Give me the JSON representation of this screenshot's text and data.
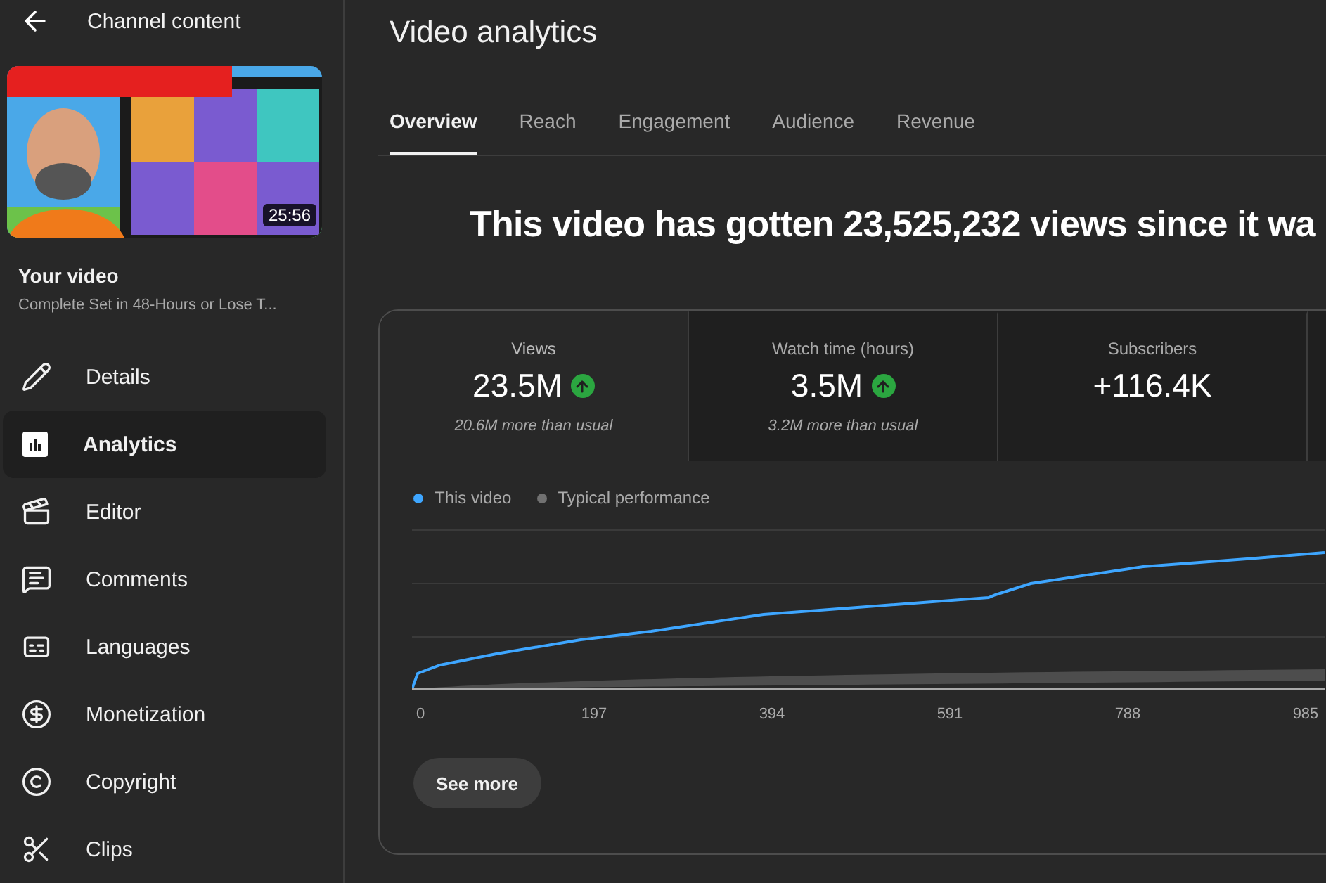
{
  "sidebar": {
    "title": "Channel content",
    "video": {
      "duration": "25:56",
      "label": "Your video",
      "name": "Complete Set in 48-Hours or Lose T..."
    },
    "items": [
      {
        "label": "Details",
        "selected": false
      },
      {
        "label": "Analytics",
        "selected": true
      },
      {
        "label": "Editor",
        "selected": false
      },
      {
        "label": "Comments",
        "selected": false
      },
      {
        "label": "Languages",
        "selected": false
      },
      {
        "label": "Monetization",
        "selected": false
      },
      {
        "label": "Copyright",
        "selected": false
      },
      {
        "label": "Clips",
        "selected": false
      }
    ]
  },
  "page_title": "Video analytics",
  "tabs": [
    {
      "label": "Overview",
      "selected": true
    },
    {
      "label": "Reach",
      "selected": false
    },
    {
      "label": "Engagement",
      "selected": false
    },
    {
      "label": "Audience",
      "selected": false
    },
    {
      "label": "Revenue",
      "selected": false
    }
  ],
  "headline": "This video has gotten 23,525,232 views since it wa",
  "metrics": [
    {
      "label": "Views",
      "value": "23.5M",
      "trending_up": true,
      "note": "20.6M more than usual",
      "selected": true
    },
    {
      "label": "Watch time (hours)",
      "value": "3.5M",
      "trending_up": true,
      "note": "3.2M more than usual",
      "selected": false
    },
    {
      "label": "Subscribers",
      "value": "+116.4K",
      "trending_up": false,
      "selected": false
    }
  ],
  "legend": [
    {
      "label": "This video",
      "color": "#3ea6ff"
    },
    {
      "label": "Typical performance",
      "color": "#717171"
    }
  ],
  "x_labels": [
    "0",
    "197",
    "394",
    "591",
    "788",
    "985"
  ],
  "see_more": "See more"
}
